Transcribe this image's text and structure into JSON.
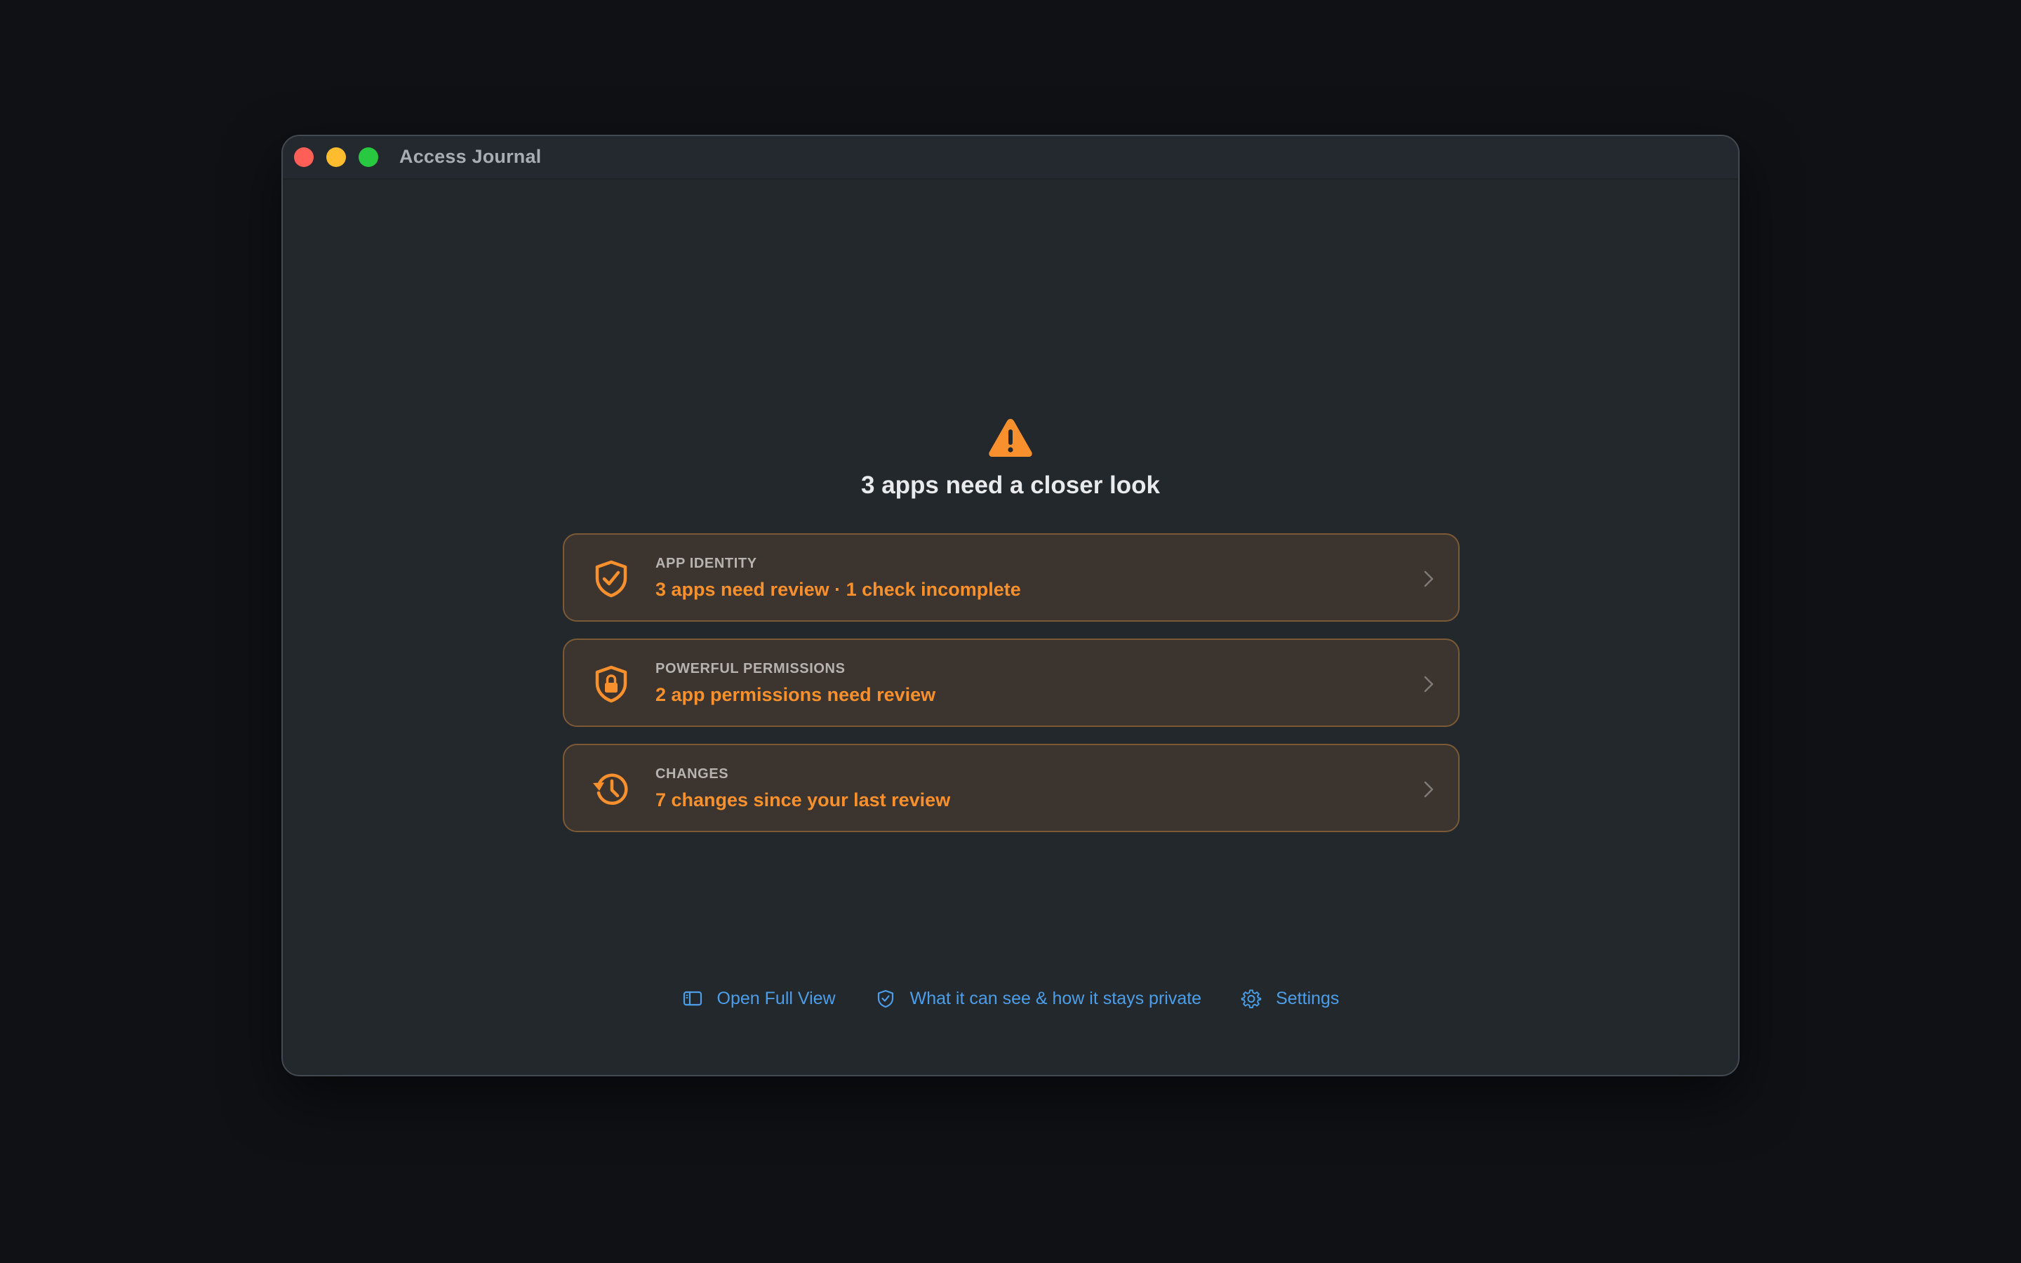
{
  "window": {
    "title": "Access Journal"
  },
  "hero": {
    "icon": "warning-triangle-icon",
    "title": "3 apps need a closer look"
  },
  "cards": [
    {
      "icon": "shield-check-icon",
      "label": "APP IDENTITY",
      "value": "3 apps need review · 1 check incomplete"
    },
    {
      "icon": "shield-lock-icon",
      "label": "POWERFUL PERMISSIONS",
      "value": "2 app permissions need review"
    },
    {
      "icon": "history-clock-icon",
      "label": "CHANGES",
      "value": "7 changes since your last review"
    }
  ],
  "links": {
    "open_full_view": "Open Full View",
    "privacy": "What it can see & how it stays private",
    "settings": "Settings"
  },
  "colors": {
    "accent_orange": "#f7902d",
    "link_blue": "#4c9ee8",
    "window_bg": "#23282d",
    "card_bg": "#3b342f",
    "card_border": "#7c5a36",
    "desktop_bg": "#0f1115"
  }
}
